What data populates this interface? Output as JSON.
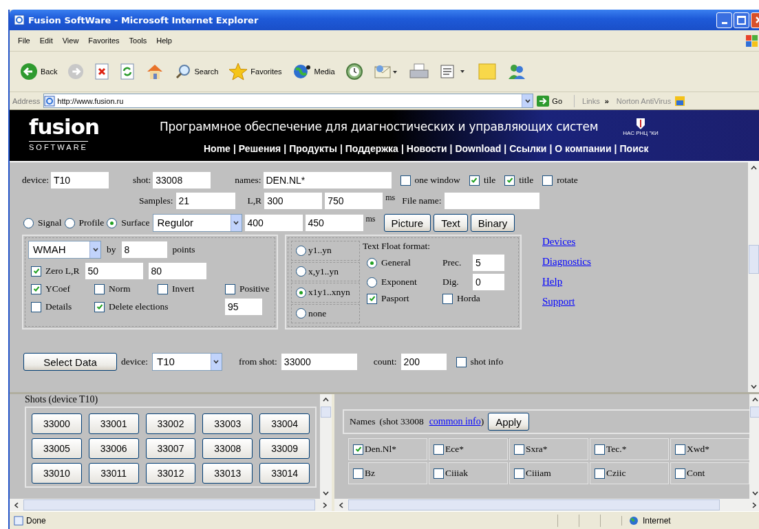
{
  "window": {
    "title": "Fusion SoftWare - Microsoft Internet Explorer"
  },
  "menu": [
    "File",
    "Edit",
    "View",
    "Favorites",
    "Tools",
    "Help"
  ],
  "toolbar": [
    {
      "kind": "back",
      "label": "Back"
    },
    {
      "kind": "forward"
    },
    {
      "kind": "stop"
    },
    {
      "kind": "refresh"
    },
    {
      "kind": "home"
    },
    {
      "kind": "search",
      "label": "Search"
    },
    {
      "kind": "favorites",
      "label": "Favorites"
    },
    {
      "kind": "media",
      "label": "Media"
    },
    {
      "kind": "history"
    },
    {
      "kind": "mail"
    },
    {
      "kind": "print"
    },
    {
      "kind": "edit"
    },
    {
      "kind": "note"
    },
    {
      "kind": "messenger"
    }
  ],
  "address": {
    "label": "Address",
    "url": "http://www.fusion.ru",
    "go": "Go",
    "links": "Links",
    "chevron": "»",
    "norton": "Norton AntiVirus"
  },
  "banner": {
    "logo": "fusion",
    "logo_sub": "SOFTWARE",
    "tagline": "Программное обеспечение для диагностических и управляющих систем",
    "badge": "НАС РНЦ \"КИ",
    "nav_separator": "|",
    "nav": [
      "Home",
      "Решения",
      "Продукты",
      "Поддержка",
      "Новости",
      "Download",
      "Ссылки",
      "О компании",
      "Поиск"
    ]
  },
  "query": {
    "device_label": "device:",
    "device": "T10",
    "shot_label": "shot:",
    "shot": "33008",
    "names_label": "names:",
    "names": "DEN.NL*",
    "options": [
      {
        "label": "one window",
        "checked": false
      },
      {
        "label": "tile",
        "checked": true
      },
      {
        "label": "title",
        "checked": true
      },
      {
        "label": "rotate",
        "checked": false
      }
    ],
    "samples_label": "Samples:",
    "samples": "21",
    "lr_label": "L,R",
    "lr": [
      "300",
      "750"
    ],
    "ms_1": "ms",
    "file_label": "File name:",
    "modes": [
      {
        "label": "Signal",
        "selected": false
      },
      {
        "label": "Profile",
        "selected": false
      },
      {
        "label": "Surface",
        "selected": true
      }
    ],
    "grid": "Regulor",
    "range": [
      "400",
      "450"
    ],
    "ms_2": "ms",
    "actions": [
      "Picture",
      "Text",
      "Binary"
    ]
  },
  "filter": {
    "method": "WMAH",
    "by_label": "by",
    "points": "8",
    "points_label": "points",
    "zero": {
      "label": "Zero L,R",
      "checked": true
    },
    "zero_values": [
      "50",
      "80"
    ],
    "flags": [
      {
        "label": "YCoef",
        "checked": true
      },
      {
        "label": "Norm",
        "checked": false
      },
      {
        "label": "Invert",
        "checked": false
      },
      {
        "label": "Positive",
        "checked": false
      },
      {
        "label": "Details",
        "checked": false
      },
      {
        "label": "Delete elections",
        "checked": true
      }
    ],
    "elections": "95"
  },
  "output": {
    "columns": [
      {
        "label": "y1..yn",
        "selected": false
      },
      {
        "label": "x,y1..yn",
        "selected": false
      },
      {
        "label": "x1y1..xnyn",
        "selected": true
      },
      {
        "label": "none",
        "selected": false
      }
    ],
    "format_title": "Text Float format:",
    "formats": [
      {
        "label": "General",
        "selected": true,
        "param_label": "Prec.",
        "param": "5"
      },
      {
        "label": "Exponent",
        "selected": false,
        "param_label": "Dig.",
        "param": "0"
      }
    ],
    "extras": [
      {
        "label": "Pasport",
        "checked": true
      },
      {
        "label": "Horda",
        "checked": false
      }
    ]
  },
  "links": [
    "Devices",
    "Diagnostics",
    "Help",
    "Support"
  ],
  "select": {
    "button": "Select Data",
    "device_label": "device:",
    "device": "T10",
    "from_label": "from shot:",
    "from": "33000",
    "count_label": "count:",
    "count": "200",
    "info": {
      "label": "shot info",
      "checked": false
    }
  },
  "shots": {
    "title": "Shots (device T10)",
    "items": [
      "33000",
      "33001",
      "33002",
      "33003",
      "33004",
      "33005",
      "33006",
      "33007",
      "33008",
      "33009",
      "33010",
      "33011",
      "33012",
      "33013",
      "33014"
    ]
  },
  "names": {
    "title": "Names",
    "shot": "(shot 33008",
    "link": "common info",
    "close": ")",
    "apply": "Apply",
    "items": [
      {
        "label": "Den.Nl*",
        "checked": true
      },
      {
        "label": "Ece*",
        "checked": false
      },
      {
        "label": "Sxra*",
        "checked": false
      },
      {
        "label": "Tec.*",
        "checked": false
      },
      {
        "label": "Xwd*",
        "checked": false
      },
      {
        "label": "Bz",
        "checked": false
      },
      {
        "label": "Ciiiak",
        "checked": false
      },
      {
        "label": "Ciiiam",
        "checked": false
      },
      {
        "label": "Cziic",
        "checked": false
      },
      {
        "label": "Cont",
        "checked": false
      }
    ]
  },
  "status": {
    "text": "Done",
    "zone": "Internet"
  }
}
